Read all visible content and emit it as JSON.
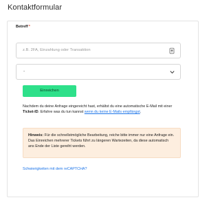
{
  "page": {
    "title": "Kontaktformular"
  },
  "form": {
    "subject_label": "Betreff",
    "required_marker": "*",
    "subject_placeholder": "z.B. 2FA, Einzahlung oder Transaktion",
    "subject_value": "",
    "category_selected": "-",
    "submit_label": "Einreichen"
  },
  "info": {
    "text_part1": "Nachdem du deine Anfrage eingereicht hast, erhältst du eine automatische E-Mail mit einer ",
    "ticket_id": "Ticket-ID",
    "text_part2": ". Erfahre was du tun kannst ",
    "link_text": "wenn du keine E-Mails empfängst",
    "text_part3": "."
  },
  "hint": {
    "title": "Hinweis:",
    "body": " Für die schnellstmögliche Bearbeitung, reiche bitte immer nur eine Anfrage ein. Das Einreichen mehrerer Tickets führt zu längeren Wartezeiten, da diese automatisch ans Ende der Liste gereiht werden."
  },
  "captcha": {
    "link_text": "Schwierigkeiten mit dem reCAPTCHA?"
  },
  "colors": {
    "accent_green": "#2ee08a",
    "link_blue": "#1a73e8",
    "hint_background": "#fdeedf",
    "required_red": "#e5533d"
  },
  "icons": {
    "subject_field_icon": "password-manager-icon",
    "select_icon": "chevron-down-icon"
  }
}
